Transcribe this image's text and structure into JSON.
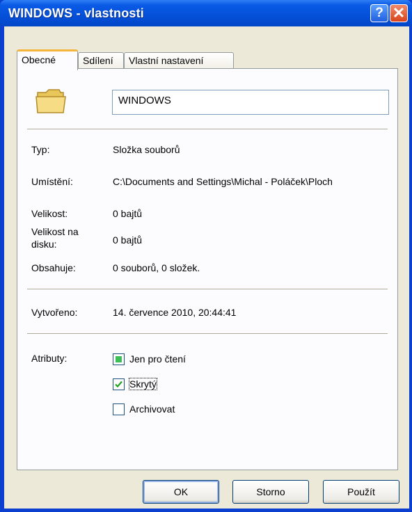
{
  "window": {
    "title": "WINDOWS - vlastnosti"
  },
  "titlebar": {
    "help_label": "?",
    "close_label": "✕"
  },
  "tabs": [
    {
      "label": "Obecné",
      "active": true
    },
    {
      "label": "Sdílení",
      "active": false
    },
    {
      "label": "Vlastní nastavení",
      "active": false
    }
  ],
  "general": {
    "folder_name": "WINDOWS",
    "type_label": "Typ:",
    "type_value": "Složka souborů",
    "location_label": "Umístění:",
    "location_value": "C:\\Documents and Settings\\Michal - Poláček\\Ploch",
    "size_label": "Velikost:",
    "size_value": "0 bajtů",
    "size_on_disk_label_1": "Velikost na",
    "size_on_disk_label_2": "disku:",
    "size_on_disk_value": "0 bajtů",
    "contains_label": "Obsahuje:",
    "contains_value": "0 souborů, 0 složek.",
    "created_label": "Vytvořeno:",
    "created_value": "14. července 2010, 20:44:41",
    "attributes_label": "Atributy:",
    "attributes": [
      {
        "label": "Jen pro čtení",
        "state": "indeterminate"
      },
      {
        "label": "Skrytý",
        "state": "checked"
      },
      {
        "label": "Archivovat",
        "state": "unchecked"
      }
    ]
  },
  "buttons": {
    "ok": "OK",
    "cancel": "Storno",
    "apply": "Použít"
  },
  "colors": {
    "titlebar": "#0a5ae6",
    "dialog_bg": "#ece9d8",
    "tab_accent": "#f3b63b",
    "indeterminate_fill": "#3cbf57"
  },
  "icons": {
    "folder": "folder-icon",
    "help": "help-icon",
    "close": "close-icon",
    "check": "check-icon"
  }
}
